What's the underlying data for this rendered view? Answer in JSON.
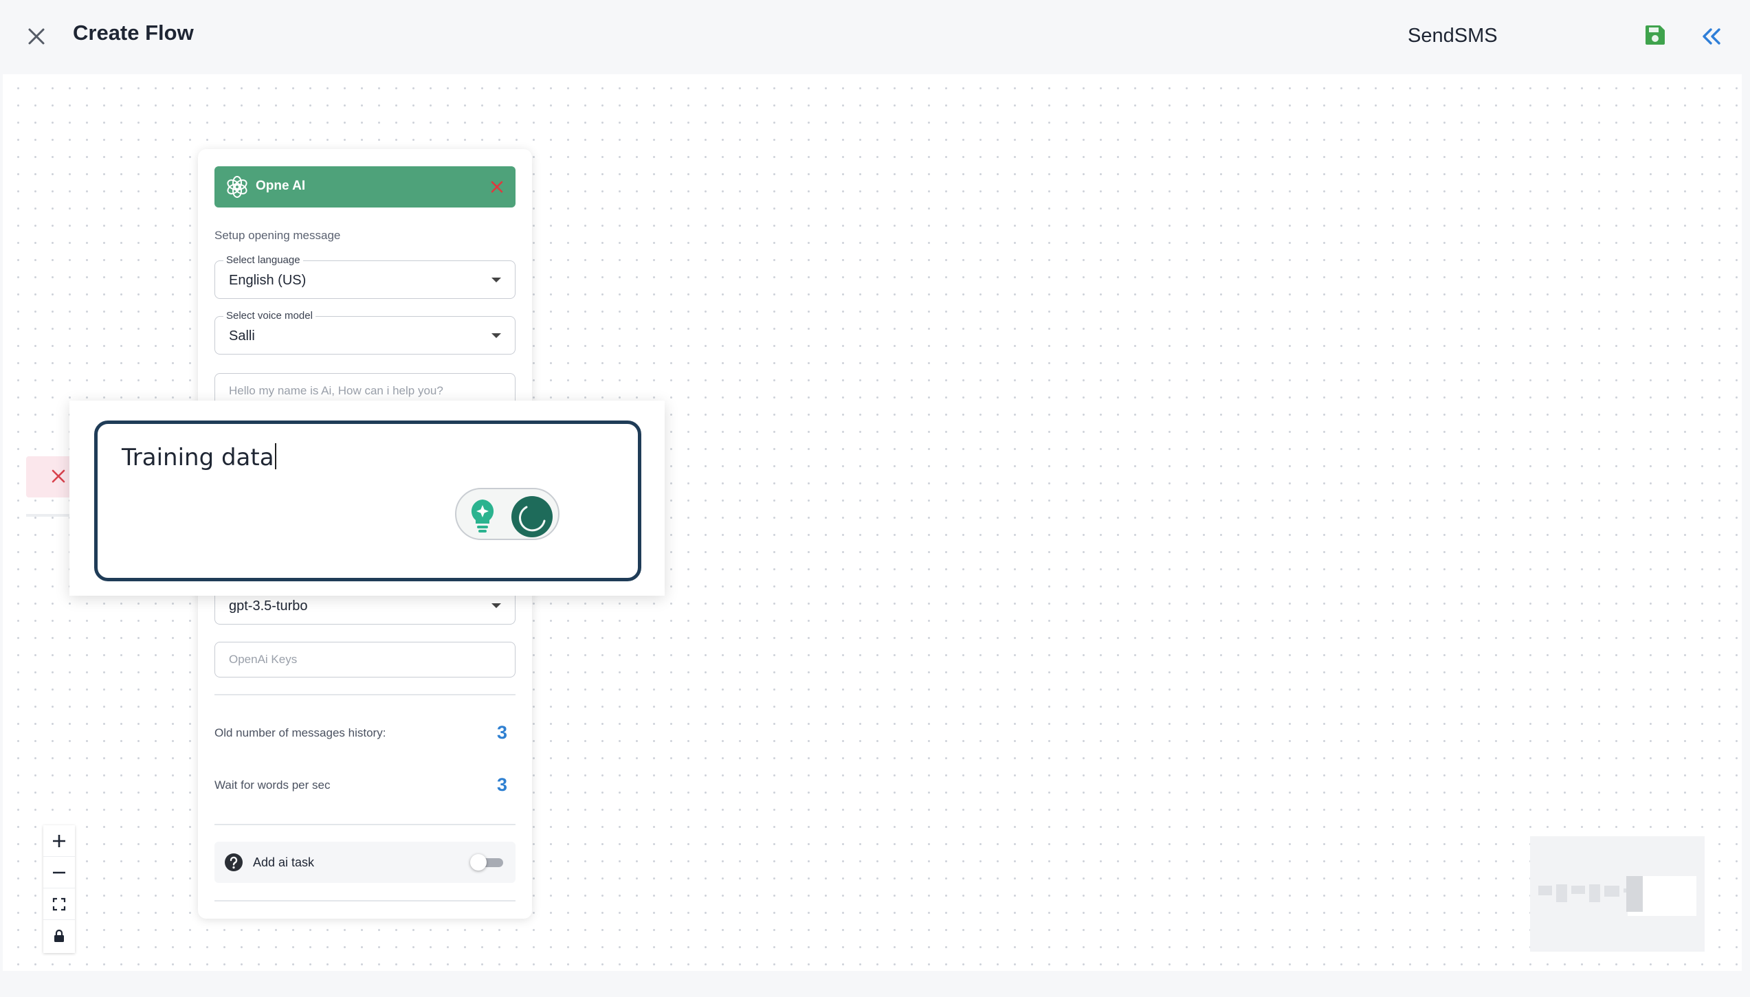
{
  "header": {
    "title": "Create Flow",
    "flow_name": "SendSMS"
  },
  "node": {
    "title": "Opne AI",
    "setup_label": "Setup opening message",
    "language": {
      "label": "Select language",
      "value": "English (US)"
    },
    "voice_model": {
      "label": "Select voice model",
      "value": "Salli"
    },
    "opening_message": {
      "placeholder": "Hello my name is Ai, How can i help you?"
    },
    "model": {
      "value": "gpt-3.5-turbo"
    },
    "openai_keys": {
      "placeholder": "OpenAi Keys"
    },
    "history": {
      "label": "Old number of messages history:",
      "value": "3"
    },
    "wait": {
      "label": "Wait for words per sec",
      "value": "3"
    },
    "ai_task": {
      "label": "Add ai task",
      "enabled": false
    }
  },
  "overlay": {
    "text": "Training data"
  },
  "colors": {
    "accent_green": "#4ea27a",
    "link_blue": "#2f80d1",
    "save_green": "#3fa34d",
    "box_border": "#1f3c57"
  },
  "icons": {
    "close": "close-icon",
    "save": "save-icon",
    "collapse": "double-chevron-left-icon",
    "openai": "openai-logo-icon",
    "help": "question-circle-icon",
    "zoom_in": "plus-icon",
    "zoom_out": "minus-icon",
    "fit": "fit-view-icon",
    "lock": "lock-icon"
  }
}
